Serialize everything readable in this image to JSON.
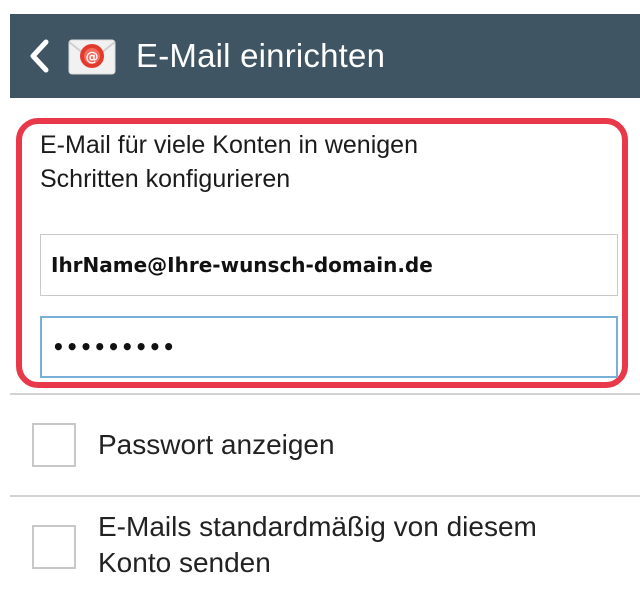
{
  "action_bar": {
    "title": "E-Mail einrichten",
    "back_icon": "chevron-left-icon",
    "app_icon": "email-envelope-icon",
    "background_color": "#3f5564"
  },
  "setup_form": {
    "intro_text_line1": "E-Mail für viele Konten in wenigen",
    "intro_text_line2": "Schritten konfigurieren",
    "email_value": "IhrName@Ihre-wunsch-domain.de",
    "password_value": "•••••••••",
    "highlight_color": "#e8384a"
  },
  "options": {
    "show_password": {
      "label": "Passwort anzeigen",
      "checked": false
    },
    "default_send": {
      "label_line1": "E-Mails standardmäßig von diesem",
      "label_line2": "Konto senden",
      "checked": false
    }
  }
}
